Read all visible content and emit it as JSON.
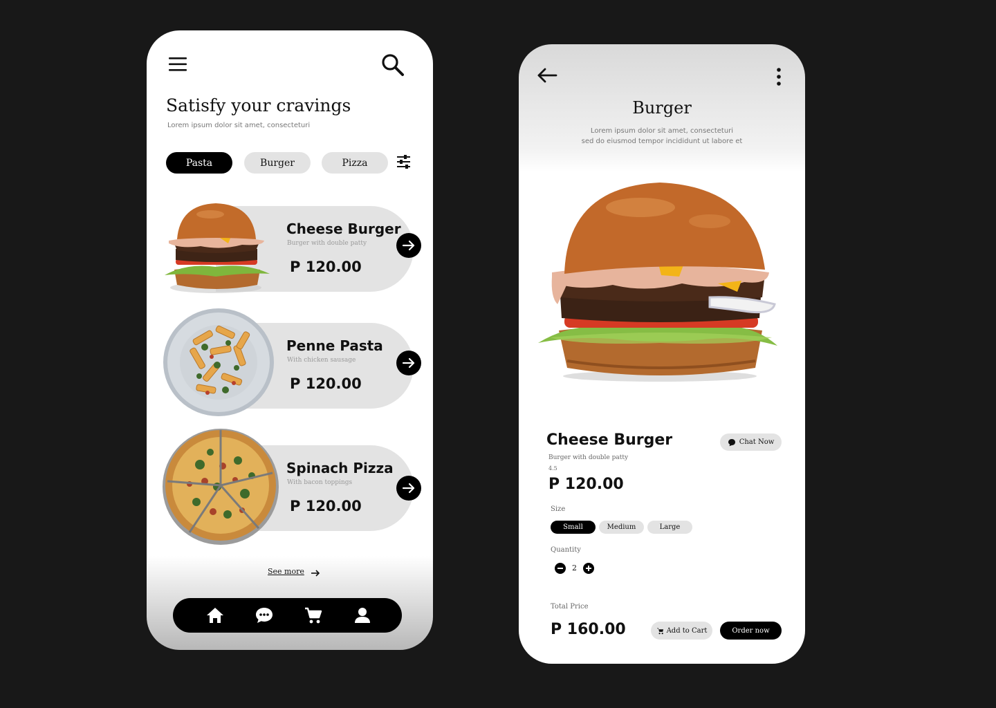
{
  "list_screen": {
    "title": "Satisfy your cravings",
    "subtitle": "Lorem ipsum dolor sit amet, consecteturi",
    "categories": [
      {
        "label": "Pasta",
        "active": true
      },
      {
        "label": "Burger",
        "active": false
      },
      {
        "label": "Pizza",
        "active": false
      }
    ],
    "items": [
      {
        "name": "Cheese Burger",
        "desc": "Burger with double patty",
        "price": "P 120.00",
        "image": "burger-image"
      },
      {
        "name": "Penne Pasta",
        "desc": "With chicken sausage",
        "price": "P 120.00",
        "image": "pasta-image"
      },
      {
        "name": "Spinach Pizza",
        "desc": "With bacon toppings",
        "price": "P 120.00",
        "image": "pizza-image"
      }
    ],
    "see_more": "See more",
    "nav": [
      "home-icon",
      "chat-icon",
      "cart-icon",
      "profile-icon"
    ]
  },
  "detail_screen": {
    "title": "Burger",
    "subtitle_line1": "Lorem ipsum dolor sit amet, consecteturi",
    "subtitle_line2": "sed do eiusmod tempor incididunt ut labore et",
    "item_name": "Cheese Burger",
    "item_desc": "Burger with double patty",
    "rating": "4.5",
    "price": "P 120.00",
    "chat_label": "Chat Now",
    "size_label": "Size",
    "sizes": [
      {
        "label": "Small",
        "active": true
      },
      {
        "label": "Medium",
        "active": false
      },
      {
        "label": "Large",
        "active": false
      }
    ],
    "quantity_label": "Quantity",
    "quantity": "2",
    "total_label": "Total Price",
    "total": "P 160.00",
    "add_to_cart": "Add to Cart",
    "order_now": "Order now"
  },
  "colors": {
    "background": "#181818",
    "chip_inactive": "#e3e3e3",
    "accent": "#000000"
  }
}
